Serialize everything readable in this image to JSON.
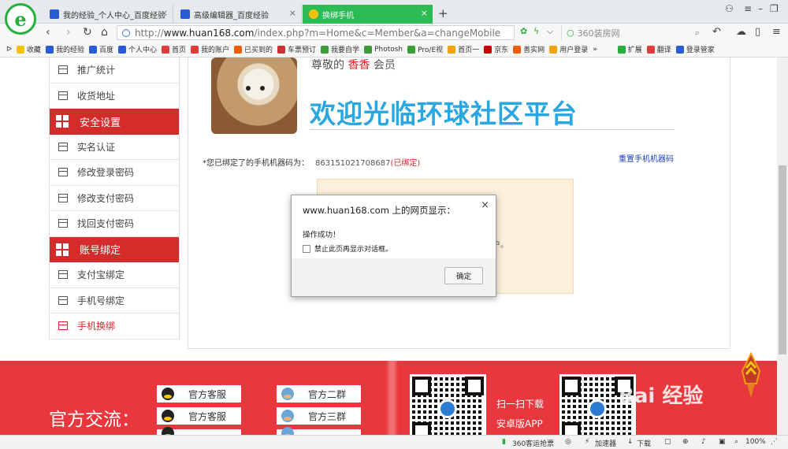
{
  "browser": {
    "logo_letter": "e",
    "tabs": [
      {
        "label": "我的经验_个人中心_百度经验",
        "active": false
      },
      {
        "label": "高级编辑器_百度经验",
        "active": false
      },
      {
        "label": "换绑手机",
        "active": true
      }
    ],
    "new_tab": "+",
    "url_prefix": "http://",
    "url_domain": "www.huan168.com",
    "url_path": "/index.php?m=Home&c=Member&a=changeMobile",
    "search_placeholder": "360装房网",
    "bookmarks": [
      "收藏",
      "我的经验",
      "百度",
      "个人中心",
      "首页",
      "我的账户",
      "已买到的",
      "车票预订",
      "我要自学",
      "Photosh",
      "Pro/E视",
      "首页一",
      "京东",
      "善实网",
      "用户登录",
      "»",
      "扩展",
      "翻译",
      "登录管家"
    ],
    "status": {
      "accelerator": "360客运抢票",
      "speedup": "加速器",
      "download": "下载",
      "zoom": "100%"
    }
  },
  "sidebar": {
    "items": [
      {
        "label": "推广统计",
        "kind": "item"
      },
      {
        "label": "收货地址",
        "kind": "item"
      },
      {
        "label": "安全设置",
        "kind": "header"
      },
      {
        "label": "实名认证",
        "kind": "item"
      },
      {
        "label": "修改登录密码",
        "kind": "item"
      },
      {
        "label": "修改支付密码",
        "kind": "item"
      },
      {
        "label": "找回支付密码",
        "kind": "item"
      },
      {
        "label": "账号绑定",
        "kind": "header"
      },
      {
        "label": "支付宝绑定",
        "kind": "item"
      },
      {
        "label": "手机号绑定",
        "kind": "item"
      },
      {
        "label": "手机换绑",
        "kind": "active"
      }
    ]
  },
  "main": {
    "greeting_prefix": "尊敬的",
    "username": "香香",
    "greeting_suffix": "会员",
    "welcome": "欢迎光临环球社区平台",
    "bind_label": "*您已绑定了的手机机器码为：",
    "bind_code": "863151021708687",
    "bind_status": "(已绑定)",
    "reset_link": "重置手机机器码",
    "notice_tail": "户。"
  },
  "dialog": {
    "title": "www.huan168.com 上的网页显示：",
    "close": "×",
    "message": "操作成功！",
    "checkbox_label": "禁止此页再显示对话框。",
    "ok": "确定"
  },
  "footer": {
    "title": "官方交流：",
    "service": [
      "官方客服",
      "官方客服"
    ],
    "groups": [
      "官方二群",
      "官方三群"
    ],
    "qr_texts": [
      "扫一扫下载",
      "安卓版APP"
    ],
    "watermark": "Bai 经验"
  },
  "colors": {
    "brand_red": "#d42b2b",
    "welcome_blue": "#2aa7e0",
    "tab_green": "#2dbb53"
  }
}
